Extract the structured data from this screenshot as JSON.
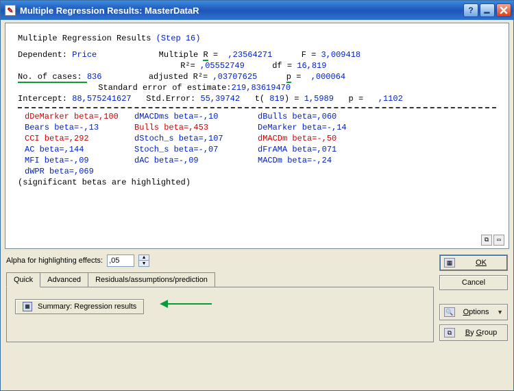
{
  "window": {
    "title": "Multiple Regression Results: MasterDataR"
  },
  "output": {
    "heading_pre": "Multiple Regression Results ",
    "heading_step": "(Step  16)",
    "dep_label": "Dependent: ",
    "dep_value": "Price",
    "multR_label": "Multiple R =  ",
    "multR_value": ",23564271",
    "F_label": "F = ",
    "F_value": "3,009418",
    "R2_label": "R²= ",
    "R2_value": ",05552749",
    "df_label": "df = ",
    "df_value": "16,819",
    "ncases_label": "No. of cases: ",
    "ncases_value": "836",
    "adjR2_label": "adjusted R²=  ",
    "adjR2_value": ",03707625",
    "p_label": "p =  ",
    "p_value": ",000064",
    "stderr_est_label": "Standard error of estimate:",
    "stderr_est_value": "219,83619470",
    "intercept_label": "Intercept: ",
    "intercept_value": "88,575241627",
    "stderr_label": "Std.Error: ",
    "stderr_value": "55,39742",
    "t_label": "t( ",
    "t_df": "819",
    "t_label2": ") = ",
    "t_value": "1,5989",
    "p2_label": "p = ",
    "p2_value": ",1102",
    "betas": [
      [
        {
          "text": "dDeMarker beta=,100",
          "cls": "red"
        },
        {
          "text": "dMACDms beta=-,10",
          "cls": "blue"
        },
        {
          "text": "dBulls beta=,060",
          "cls": "blue"
        }
      ],
      [
        {
          "text": "Bears beta=-,13",
          "cls": "blue"
        },
        {
          "text": "Bulls beta=,453",
          "cls": "red"
        },
        {
          "text": "DeMarker beta=-,14",
          "cls": "blue"
        }
      ],
      [
        {
          "text": "CCI beta=,292",
          "cls": "red"
        },
        {
          "text": "dStoch_s beta=,107",
          "cls": "blue"
        },
        {
          "text": "dMACDm beta=-,50",
          "cls": "red"
        }
      ],
      [
        {
          "text": "AC beta=,144",
          "cls": "blue"
        },
        {
          "text": "Stoch_s beta=-,07",
          "cls": "blue"
        },
        {
          "text": "dFrAMA beta=,071",
          "cls": "blue"
        }
      ],
      [
        {
          "text": "MFI beta=-,09",
          "cls": "blue"
        },
        {
          "text": "dAC beta=-,09",
          "cls": "blue"
        },
        {
          "text": "MACDm beta=-,24",
          "cls": "blue"
        }
      ],
      [
        {
          "text": "dWPR beta=,069",
          "cls": "blue"
        },
        {
          "text": "",
          "cls": ""
        },
        {
          "text": "",
          "cls": ""
        }
      ]
    ],
    "sig_note": "(significant betas are highlighted)"
  },
  "controls": {
    "alpha_label": "Alpha for highlighting effects:",
    "alpha_value": ",05",
    "tabs": [
      "Quick",
      "Advanced",
      "Residuals/assumptions/prediction"
    ],
    "summary_btn": "Summary:  Regression results"
  },
  "buttons": {
    "ok": "OK",
    "cancel": "Cancel",
    "options": "Options",
    "bygroup": "By Group"
  }
}
